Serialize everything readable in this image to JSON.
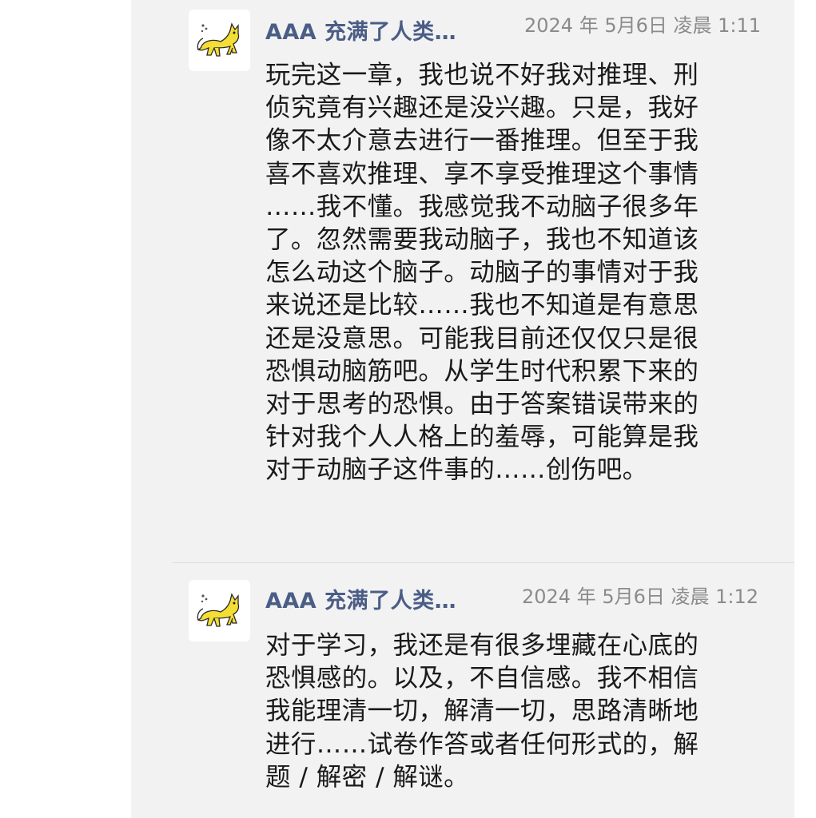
{
  "messages": [
    {
      "username": "AAA 充满了人类…",
      "timestamp": "2024 年 5月6日 凌晨 1:11",
      "text": "玩完这一章，我也说不好我对推理、刑\n侦究竟有兴趣还是没兴趣。只是，我好\n像不太介意去进行一番推理。但至于我\n喜不喜欢推理、享不享受推理这个事情\n……我不懂。我感觉我不动脑子很多年\n了。忽然需要我动脑子，我也不知道该\n怎么动这个脑子。动脑子的事情对于我\n来说还是比较……我也不知道是有意思\n还是没意思。可能我目前还仅仅只是很\n恐惧动脑筋吧。从学生时代积累下来的\n对于思考的恐惧。由于答案错误带来的\n针对我个人人格上的羞辱，可能算是我\n对于动脑子这件事的……创伤吧。",
      "avatar_icon": "yellow-cat-icon"
    },
    {
      "username": "AAA 充满了人类…",
      "timestamp": "2024 年 5月6日 凌晨 1:12",
      "text": "对于学习，我还是有很多埋藏在心底的\n恐惧感的。以及，不自信感。我不相信\n我能理清一切，解清一切，思路清晰地\n进行……试卷作答或者任何形式的，解\n题 / 解密 / 解谜。",
      "avatar_icon": "yellow-cat-icon"
    }
  ],
  "colors": {
    "username": "#4a5d86",
    "timestamp": "#8b8b8b",
    "panel_bg": "#f2f2f2",
    "cat_yellow": "#f4de35"
  }
}
